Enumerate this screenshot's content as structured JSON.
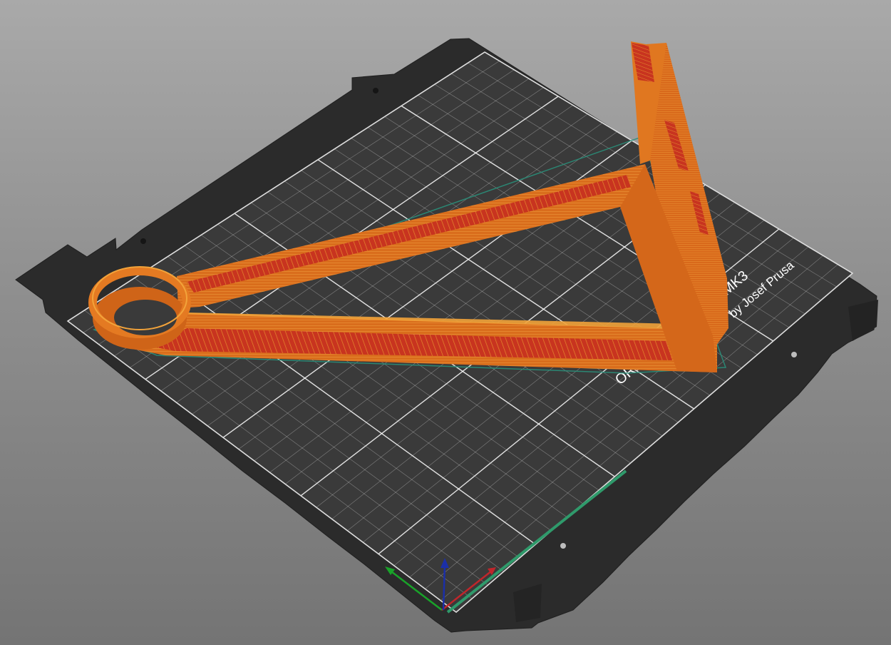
{
  "view": {
    "background_top": "#a9a9a9",
    "background_bottom": "#747474"
  },
  "bed": {
    "plate_color": "#2b2b2b",
    "grid_color": "#ffffff",
    "logo_line_1": "ORIGINAL PRUSA i3 MK3",
    "logo_line_2": "by Josef Prusa"
  },
  "model": {
    "perimeter_color": "#e0761e",
    "infill_color": "#c8341f",
    "highlight_color": "#f2a33a"
  },
  "axes": {
    "x_color": "#c0262b",
    "y_color": "#19a329",
    "z_color": "#1b2fa8",
    "selection_edge_color": "#2f9a6b"
  }
}
